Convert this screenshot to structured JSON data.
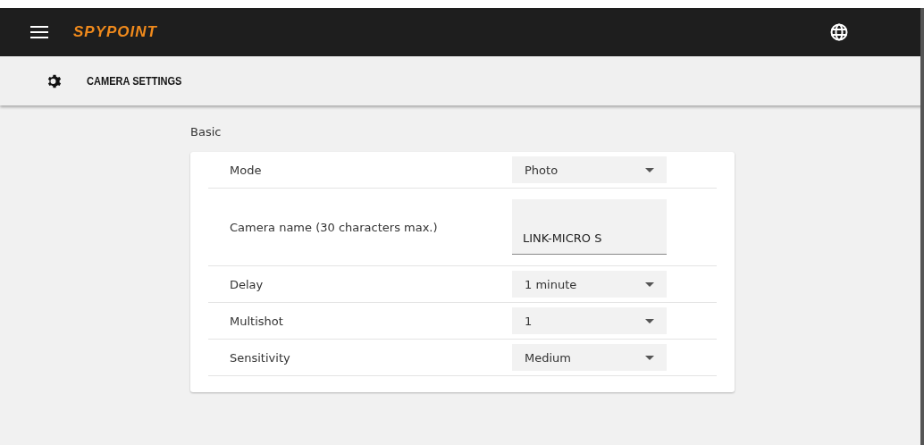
{
  "header": {
    "brand": "SPYPOINT"
  },
  "toolbar": {
    "title": "CAMERA SETTINGS"
  },
  "section": {
    "title": "Basic"
  },
  "settings": [
    {
      "kind": "select",
      "label": "Mode",
      "value": "Photo"
    },
    {
      "kind": "text",
      "label": "Camera name (30 characters max.)",
      "value": "LINK-MICRO S"
    },
    {
      "kind": "select",
      "label": "Delay",
      "value": "1 minute"
    },
    {
      "kind": "select",
      "label": "Multishot",
      "value": "1"
    },
    {
      "kind": "select",
      "label": "Sensitivity",
      "value": "Medium"
    }
  ]
}
